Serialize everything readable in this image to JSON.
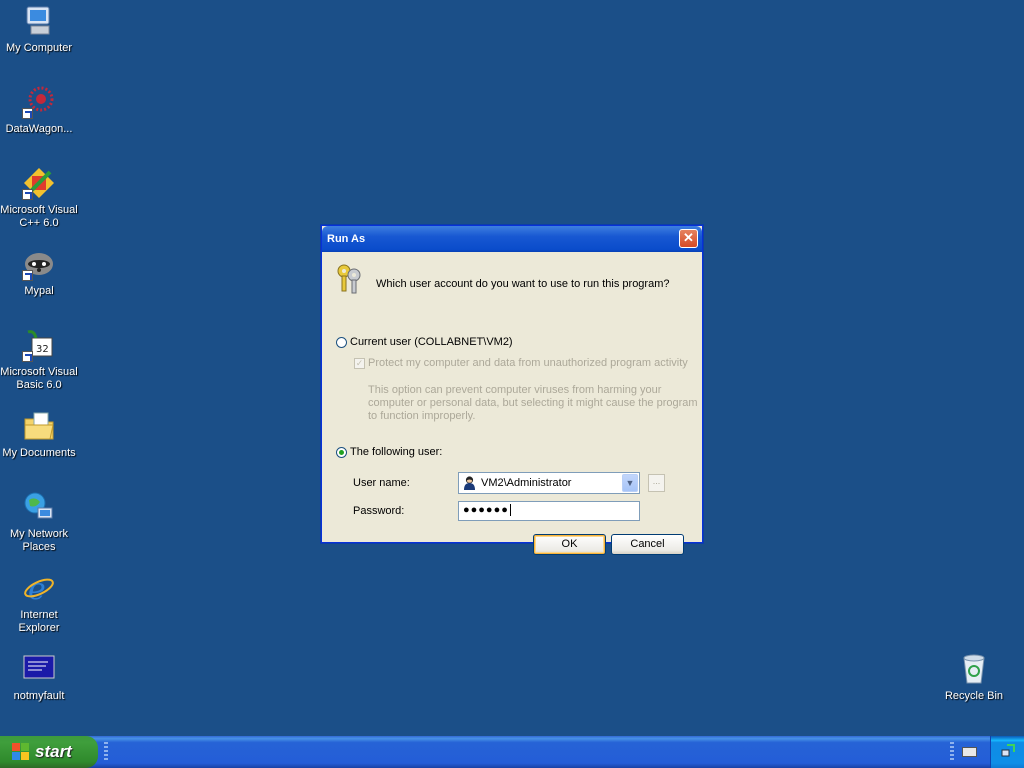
{
  "desktop": {
    "icons": [
      {
        "label": "My Computer",
        "icon": "my-computer-icon"
      },
      {
        "label": "DataWagon...",
        "icon": "datawagon-icon"
      },
      {
        "label": "Microsoft Visual C++ 6.0",
        "icon": "visual-cpp-icon"
      },
      {
        "label": "Mypal",
        "icon": "mypal-raccoon-icon"
      },
      {
        "label": "Microsoft Visual Basic 6.0",
        "icon": "visual-basic-icon"
      },
      {
        "label": "My Documents",
        "icon": "my-documents-folder-icon"
      },
      {
        "label": "My Network Places",
        "icon": "network-places-icon"
      },
      {
        "label": "Internet Explorer",
        "icon": "internet-explorer-icon"
      },
      {
        "label": "notmyfault",
        "icon": "notmyfault-icon"
      },
      {
        "label": "Recycle Bin",
        "icon": "recycle-bin-icon"
      }
    ]
  },
  "dialog": {
    "title": "Run As",
    "close_glyph": "✕",
    "question": "Which user account do you want to use to run this program?",
    "current_user_label": "Current user (COLLABNET\\VM2)",
    "protect_label": "Protect my computer and data from unauthorized program activity",
    "protect_description": "This option can prevent computer viruses from harming your computer or personal data, but selecting it might cause the program to function improperly.",
    "following_user_label": "The following user:",
    "username_label": "User name:",
    "username_value": "VM2\\Administrator",
    "password_label": "Password:",
    "password_masked": "●●●●●●",
    "browse_label": "...",
    "ok_label": "OK",
    "cancel_label": "Cancel",
    "selected_option": "The following user:",
    "protect_checked": true
  },
  "taskbar": {
    "start_label": "start"
  },
  "colors": {
    "desktop_bg": "#1b4f88",
    "title_bar": "#0a4ccb",
    "dialog_bg": "#ece9d8",
    "start_green": "#3f9e3c"
  }
}
